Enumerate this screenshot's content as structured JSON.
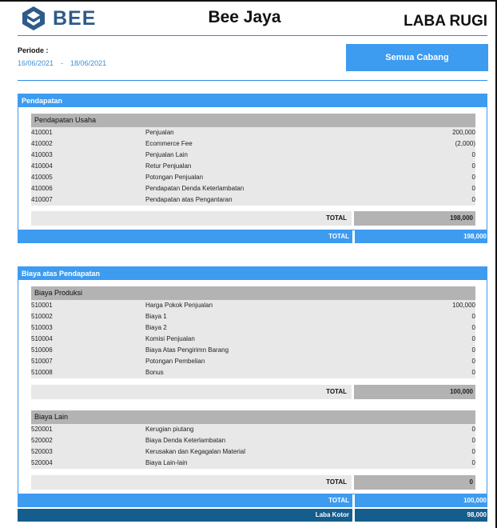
{
  "header": {
    "logo_text": "BEE",
    "company": "Bee Jaya",
    "report_title": "LABA RUGI",
    "periode_label": "Periode :",
    "date_from": "16/06/2021",
    "date_separator": "-",
    "date_to": "18/06/2021",
    "branch_button": "Semua Cabang"
  },
  "colors": {
    "accent": "#3d9bf0",
    "brand": "#2d5b8a",
    "dark_bar": "#145d8c",
    "gray_header": "#b3b3b3",
    "row_bg": "#e8e8e8"
  },
  "pendapatan": {
    "title": "Pendapatan",
    "group": {
      "title": "Pendapatan Usaha",
      "rows": [
        {
          "code": "410001",
          "name": "Penjualan",
          "value": "200,000"
        },
        {
          "code": "410002",
          "name": "Ecommerce Fee",
          "value": "(2,000)"
        },
        {
          "code": "410003",
          "name": "Penjualan Lain",
          "value": "0"
        },
        {
          "code": "410004",
          "name": "Retur Penjualan",
          "value": "0"
        },
        {
          "code": "410005",
          "name": "Potongan Penjualan",
          "value": "0"
        },
        {
          "code": "410006",
          "name": "Pendapatan Denda Keterlambatan",
          "value": "0"
        },
        {
          "code": "410007",
          "name": "Pendapatan atas Pengantaran",
          "value": "0"
        }
      ],
      "total_label": "TOTAL",
      "total_value": "198,000"
    },
    "total_label": "TOTAL",
    "total_value": "198,000"
  },
  "biaya": {
    "title": "Biaya atas Pendapatan",
    "produksi": {
      "title": "Biaya Produksi",
      "rows": [
        {
          "code": "510001",
          "name": "Harga Pokok Penjualan",
          "value": "100,000"
        },
        {
          "code": "510002",
          "name": "Biaya 1",
          "value": "0"
        },
        {
          "code": "510003",
          "name": "Biaya 2",
          "value": "0"
        },
        {
          "code": "510004",
          "name": "Komisi Penjualan",
          "value": "0"
        },
        {
          "code": "510006",
          "name": "Biaya Atas Pengirimn Barang",
          "value": "0"
        },
        {
          "code": "510007",
          "name": "Potongan Pembelian",
          "value": "0"
        },
        {
          "code": "510008",
          "name": "Bonus",
          "value": "0"
        }
      ],
      "total_label": "TOTAL",
      "total_value": "100,000"
    },
    "lain": {
      "title": "Biaya Lain",
      "rows": [
        {
          "code": "520001",
          "name": "Kerugian piutang",
          "value": "0"
        },
        {
          "code": "520002",
          "name": "Biaya Denda Keterlambatan",
          "value": "0"
        },
        {
          "code": "520003",
          "name": "Kerusakan dan Kegagalan Material",
          "value": "0"
        },
        {
          "code": "520004",
          "name": "Biaya Lain-lain",
          "value": "0"
        }
      ],
      "total_label": "TOTAL",
      "total_value": "0"
    },
    "total_label": "TOTAL",
    "total_value": "100,000"
  },
  "laba_kotor": {
    "label": "Laba Kotor",
    "value": "98,000"
  }
}
